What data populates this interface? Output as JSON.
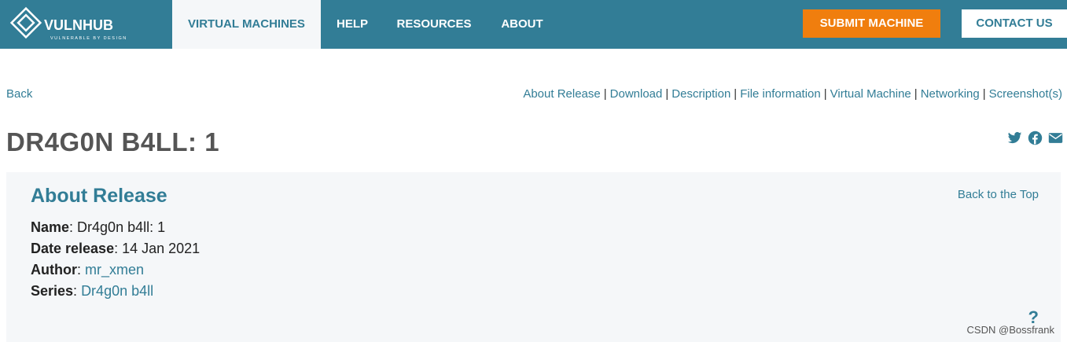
{
  "brand": {
    "logo_main": "VULNHUB",
    "logo_tagline": "VULNERABLE BY DESIGN"
  },
  "nav": {
    "items": [
      {
        "label": "VIRTUAL MACHINES",
        "active": true
      },
      {
        "label": "HELP",
        "active": false
      },
      {
        "label": "RESOURCES",
        "active": false
      },
      {
        "label": "ABOUT",
        "active": false
      }
    ],
    "submit_label": "SUBMIT MACHINE",
    "contact_label": "CONTACT US"
  },
  "links": {
    "back": "Back",
    "sections": [
      "About Release",
      "Download",
      "Description",
      "File information",
      "Virtual Machine",
      "Networking",
      "Screenshot(s)"
    ],
    "separator": "|"
  },
  "page": {
    "title": "DR4G0N B4LL: 1"
  },
  "share_icons": [
    "twitter-icon",
    "facebook-icon",
    "email-icon"
  ],
  "about": {
    "heading": "About Release",
    "back_to_top": "Back to the Top",
    "name_label": "Name",
    "name_value": "Dr4g0n b4ll: 1",
    "date_label": "Date release",
    "date_value": "14 Jan 2021",
    "author_label": "Author",
    "author_value": "mr_xmen",
    "series_label": "Series",
    "series_value": "Dr4g0n b4ll"
  },
  "help_icon": "?",
  "watermark": "CSDN @Bossfrank",
  "colors": {
    "nav_bg": "#327d96",
    "accent": "#327d96",
    "submit_bg": "#f07e0e",
    "panel_bg": "#f5f7f9",
    "logo_orange": "#f07e0e"
  }
}
